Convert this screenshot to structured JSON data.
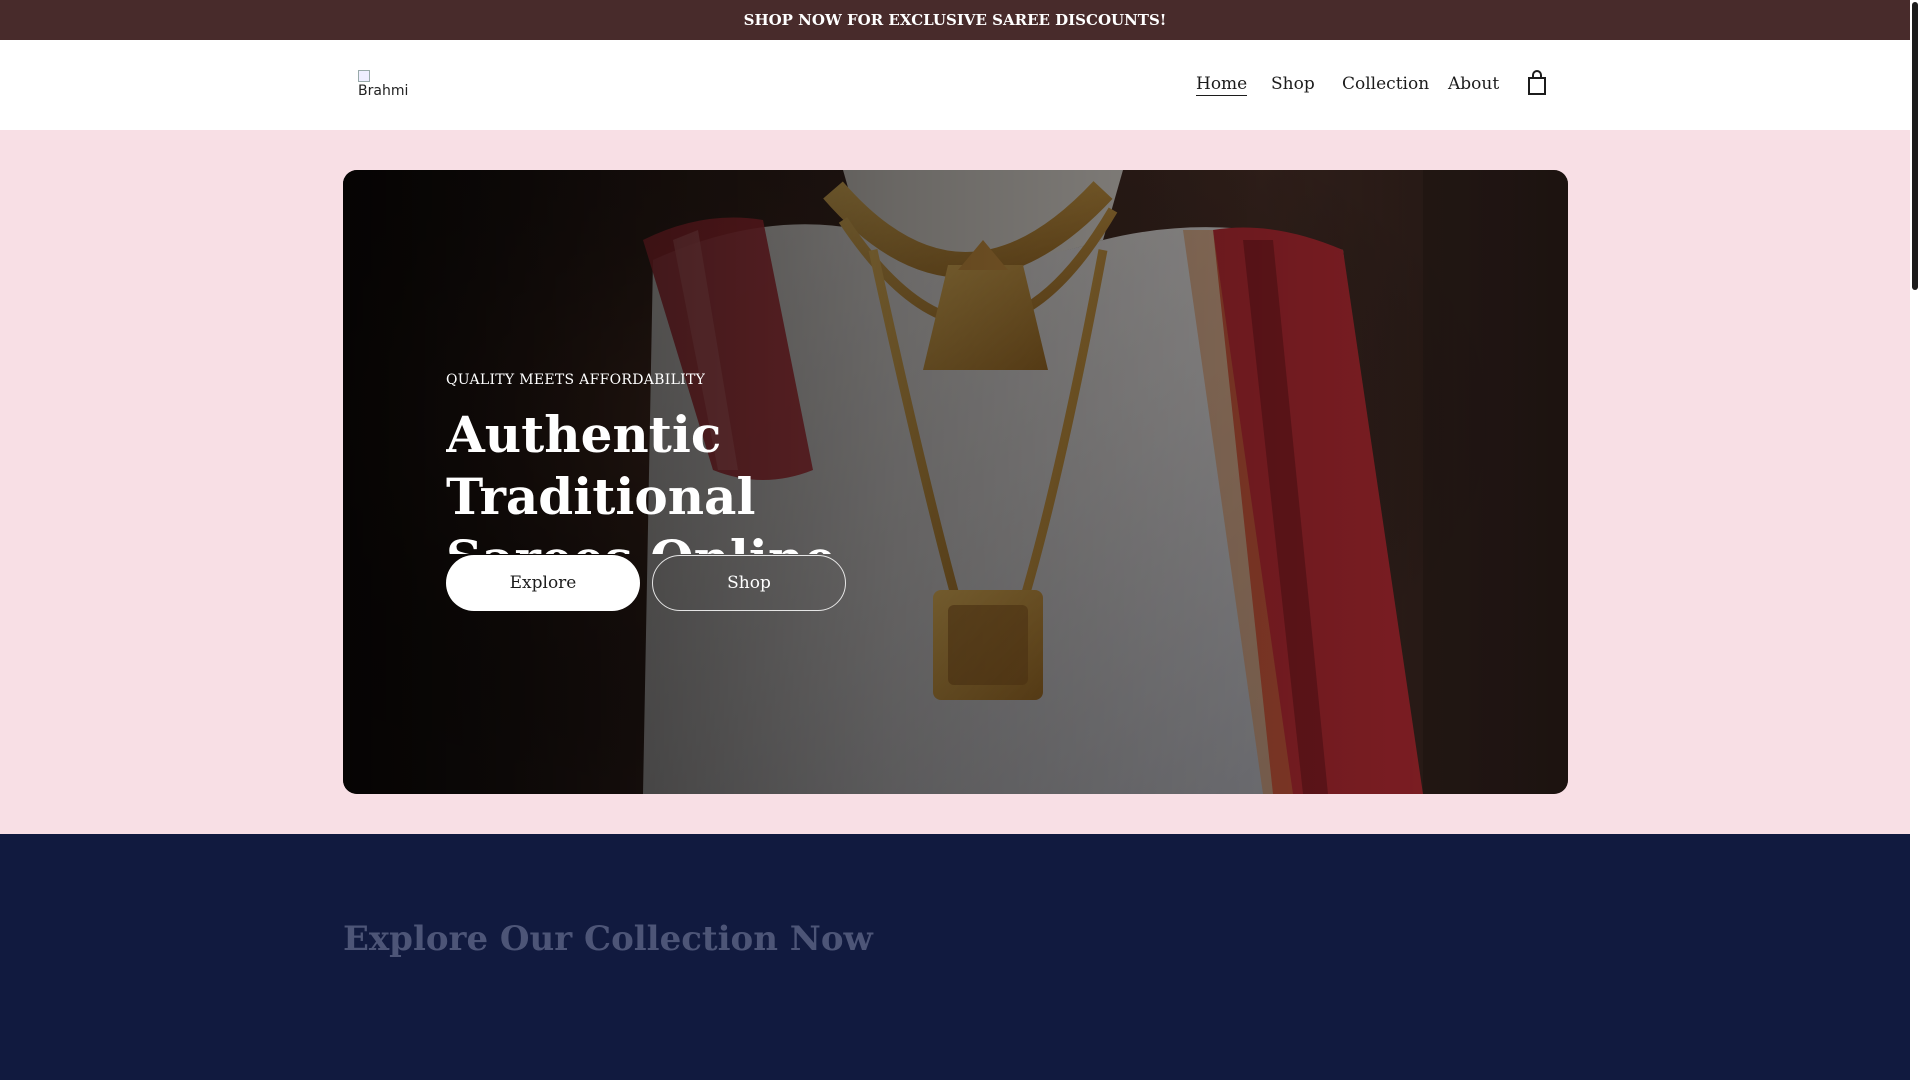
{
  "announcement": {
    "text": "SHOP NOW FOR EXCLUSIVE SAREE DISCOUNTS!"
  },
  "header": {
    "logo_alt": "Brahmi",
    "nav": [
      {
        "label": "Home",
        "active": true
      },
      {
        "label": "Shop",
        "active": false
      },
      {
        "label": "Collection",
        "active": false
      },
      {
        "label": "About",
        "active": false
      }
    ],
    "cart_icon": "shopping-bag-icon"
  },
  "hero": {
    "eyebrow": "QUALITY MEETS AFFORDABILITY",
    "title": "Authentic Traditional Sarees Online",
    "buttons": {
      "explore": "Explore",
      "shop": "Shop"
    }
  },
  "collection": {
    "title": "Explore Our Collection Now"
  },
  "colors": {
    "announcement_bg": "#482b2b",
    "page_bg": "#f8dfe5",
    "collection_bg": "#111a3f",
    "collection_title": "#4d5577"
  }
}
